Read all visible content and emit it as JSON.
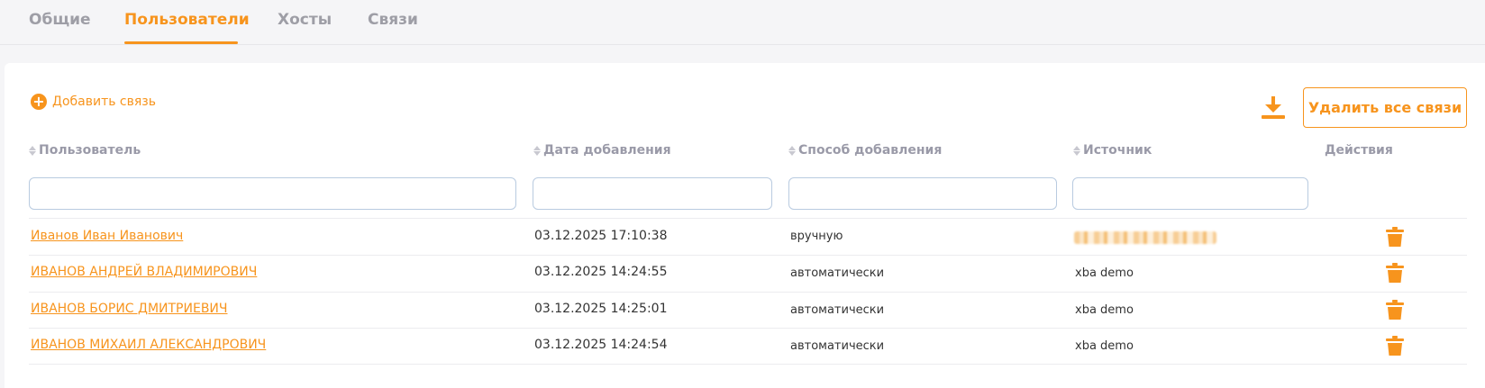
{
  "tabs": [
    "Общие",
    "Пользователи",
    "Хосты",
    "Связи"
  ],
  "toolbar": {
    "add_label": "Добавить связь",
    "add_icon": "plus-circle-icon",
    "download_icon": "download-icon",
    "delete_all_label": "Удалить все связи"
  },
  "table": {
    "columns": [
      "Пользователь",
      "Дата добавления",
      "Способ добавления",
      "Источник",
      "Действия"
    ],
    "filters": [
      "",
      "",
      "",
      ""
    ],
    "rows": [
      {
        "user": "Иванов Иван Иванович",
        "date": "03.12.2025 17:10:38",
        "method": "вручную",
        "source": ""
      },
      {
        "user": "ИВАНОВ АНДРЕЙ ВЛАДИМИРОВИЧ",
        "date": "03.12.2025 14:24:55",
        "method": "автоматически",
        "source": "xba demo"
      },
      {
        "user": "ИВАНОВ БОРИС ДМИТРИЕВИЧ",
        "date": "03.12.2025 14:25:01",
        "method": "автоматически",
        "source": "xba demo"
      },
      {
        "user": "ИВАНОВ МИХАИЛ АЛЕКСАНДРОВИЧ",
        "date": "03.12.2025 14:24:54",
        "method": "автоматически",
        "source": "xba demo"
      }
    ],
    "delete_icon": "trash-icon"
  },
  "colors": {
    "accent": "#f7941d",
    "header_text": "#9a9aa8"
  }
}
